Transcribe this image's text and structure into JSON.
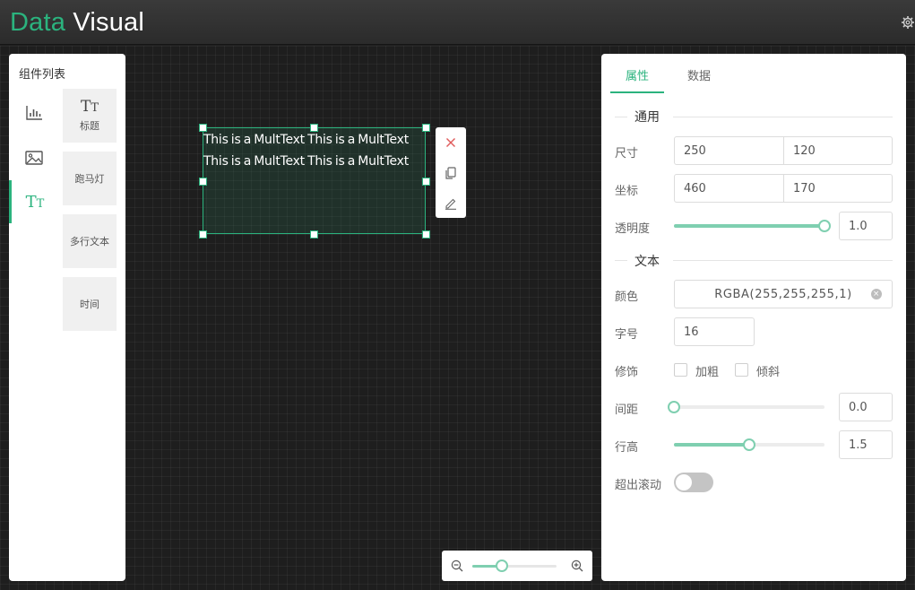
{
  "colors": {
    "accent": "#2bb37e",
    "accent_light": "#7fcfb0",
    "header_bg": "#333333",
    "canvas_bg": "#1e1e1e"
  },
  "header": {
    "logo_part1": "Data",
    "logo_part2": "Visual",
    "settings_icon": "gear-icon"
  },
  "left_panel": {
    "title": "组件列表",
    "categories": [
      {
        "icon": "bar-chart-icon"
      },
      {
        "icon": "image-icon"
      },
      {
        "icon": "text-type-icon",
        "active": true
      }
    ],
    "components": [
      {
        "icon_text": "TT",
        "label": "标题"
      },
      {
        "label": "跑马灯"
      },
      {
        "label": "多行文本"
      },
      {
        "label": "时间"
      }
    ]
  },
  "canvas": {
    "multitext": {
      "text": "This is a MultText This is a MultText This is a MultText This is a MultText"
    },
    "toolbar": {
      "delete": "close-icon",
      "copy": "copy-icon",
      "edit": "edit-icon"
    },
    "zoom": {
      "level": 0.35
    }
  },
  "right_panel": {
    "tabs": [
      {
        "label": "属性",
        "active": true
      },
      {
        "label": "数据"
      }
    ],
    "section_general": "通用",
    "size_label": "尺寸",
    "size_w": "250",
    "size_h": "120",
    "pos_label": "坐标",
    "pos_x": "460",
    "pos_y": "170",
    "opacity_label": "透明度",
    "opacity_value": "1.0",
    "opacity_fraction": 1.0,
    "section_text": "文本",
    "color_label": "颜色",
    "color_value": "RGBA(255,255,255,1)",
    "fontsize_label": "字号",
    "fontsize_value": "16",
    "decor_label": "修饰",
    "bold_label": "加粗",
    "italic_label": "倾斜",
    "spacing_label": "间距",
    "spacing_value": "0.0",
    "spacing_fraction": 0.0,
    "lineheight_label": "行高",
    "lineheight_value": "1.5",
    "lineheight_fraction": 0.5,
    "scroll_label": "超出滚动",
    "scroll_on": false
  }
}
